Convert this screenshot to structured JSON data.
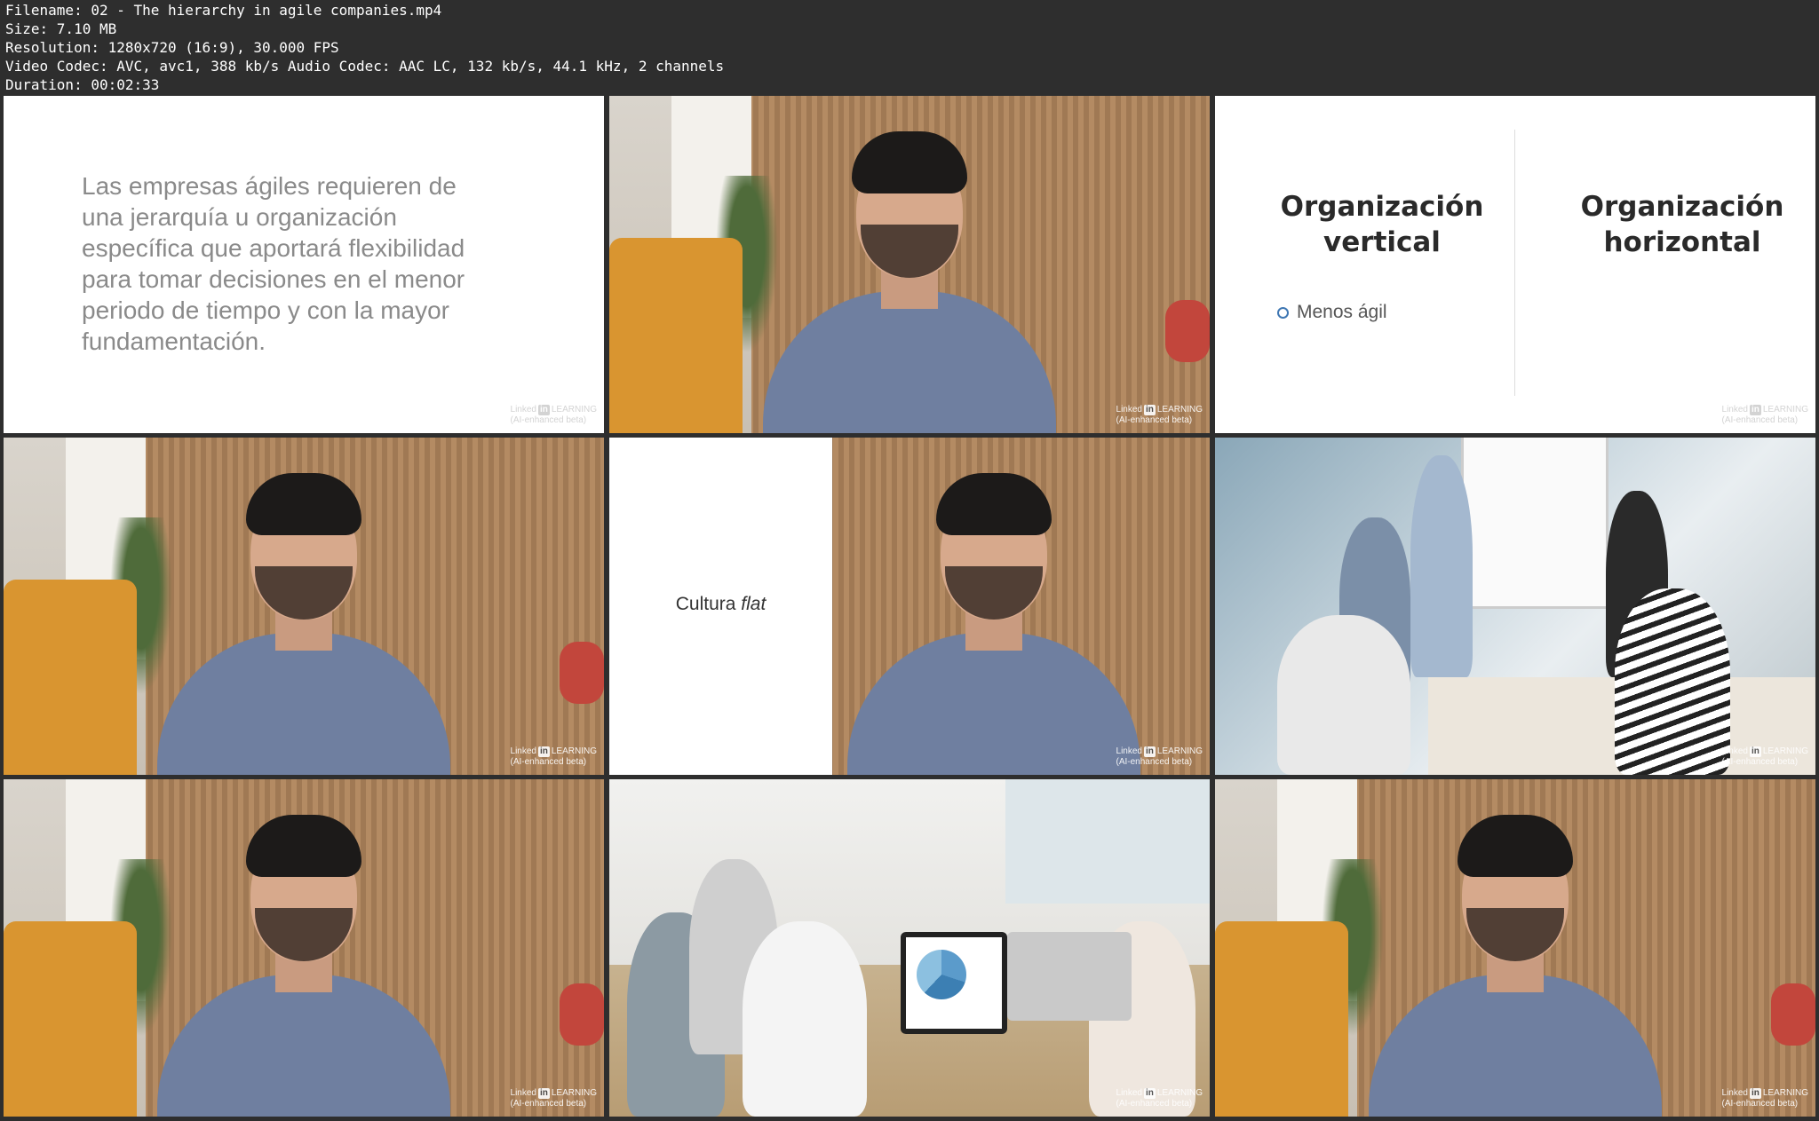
{
  "header": {
    "filename": "Filename: 02 - The hierarchy in agile companies.mp4",
    "size": "Size: 7.10 MB",
    "resolution": "Resolution: 1280x720 (16:9), 30.000 FPS",
    "codec": "Video Codec: AVC, avc1, 388 kb/s Audio Codec: AAC LC, 132 kb/s, 44.1 kHz, 2 channels",
    "duration": "Duration: 00:02:33"
  },
  "branding": {
    "logo_word": "Linked",
    "logo_in": "in",
    "logo_suffix": "LEARNING",
    "logo_sub": "(AI-enhanced beta)"
  },
  "slide1": {
    "text": "Las empresas ágiles requieren de una jerarquía u organización específica que aportará flexibilidad para tomar decisiones en el menor periodo de tiempo y con la mayor fundamentación."
  },
  "slide3": {
    "col1_title": "Organización vertical",
    "col2_title": "Organización horizontal",
    "bullet": "Menos ágil"
  },
  "slide5": {
    "text_plain": "Cultura",
    "text_italic": "flat"
  }
}
